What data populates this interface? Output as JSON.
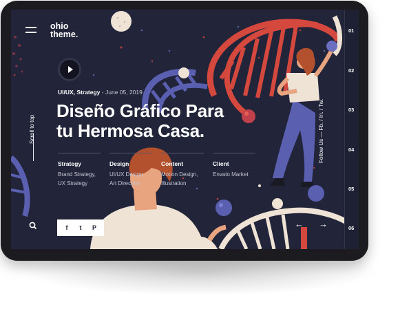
{
  "brand": {
    "logo_text": "ohio\ntheme."
  },
  "post": {
    "categories": "UI/UX, Strategy",
    "separator": " - ",
    "date": "June 05, 2019",
    "title_line1": "Diseño Gráfico Para",
    "title_line2": "tu Hermosa Casa."
  },
  "details": [
    {
      "heading": "Strategy",
      "value_line1": "Brand Strategy,",
      "value_line2": "UX Strategy"
    },
    {
      "heading": "Design",
      "value_line1": "UI/UX Design,",
      "value_line2": "Art Direction"
    },
    {
      "heading": "Content",
      "value_line1": "Motion Design,",
      "value_line2": "Illustration"
    },
    {
      "heading": "Client",
      "value_line1": "Envato Market",
      "value_line2": ""
    }
  ],
  "sidebar": {
    "scroll_to_top": "Scroll to top"
  },
  "social": {
    "facebook": "f",
    "twitter": "t",
    "pinterest": "P"
  },
  "follow": {
    "text": "Follow Us  —  Fb.  /  In.  /  Tw."
  },
  "slides": {
    "numbers": [
      "01",
      "02",
      "03",
      "04",
      "05",
      "06"
    ],
    "prev_arrow": "←",
    "next_arrow": "→"
  },
  "icons": [
    "menu-icon",
    "play-icon",
    "search-icon",
    "facebook-icon",
    "twitter-icon",
    "pinterest-icon",
    "arrow-left-icon",
    "arrow-right-icon"
  ],
  "colors": {
    "background": "#22253a",
    "red": "#d5483d",
    "blue_purple": "#5a5fb0",
    "cream": "#efe3d6",
    "skin": "#e8a47f",
    "hair": "#b3502e"
  }
}
